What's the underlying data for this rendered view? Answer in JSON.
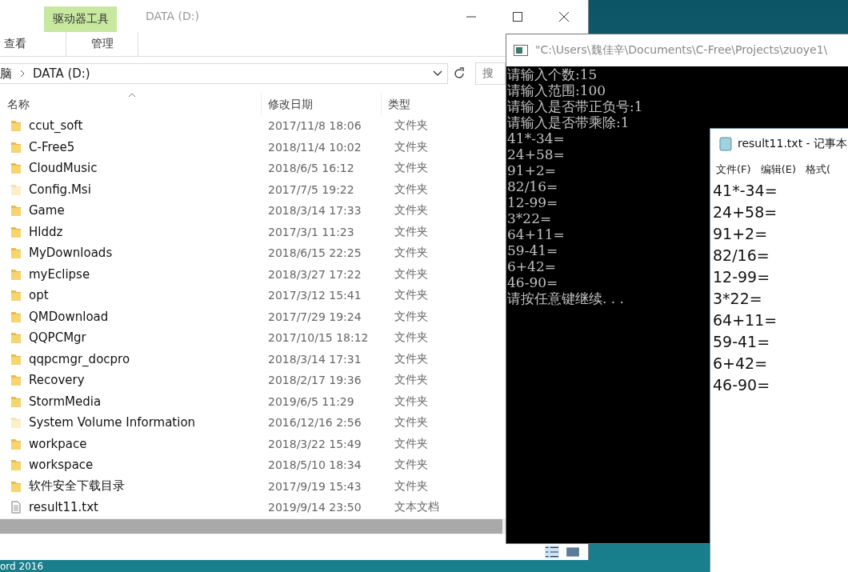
{
  "desktop": {
    "icon_label": "ord 2016"
  },
  "explorer": {
    "title": "DATA (D:)",
    "context_tab": "驱动器工具",
    "ribbon_tabs": [
      {
        "label": "查看",
        "contextual": false
      },
      {
        "label": "管理",
        "contextual": true
      }
    ],
    "address": {
      "path": [
        "脑",
        "DATA (D:)"
      ]
    },
    "search": {
      "placeholder": "搜"
    },
    "columns": [
      "名称",
      "修改日期",
      "类型"
    ],
    "files": [
      {
        "name": "ccut_soft",
        "date": "2017/11/8 18:06",
        "type": "文件夹",
        "kind": "folder",
        "hidden": false
      },
      {
        "name": "C-Free5",
        "date": "2018/11/4 10:02",
        "type": "文件夹",
        "kind": "folder",
        "hidden": false
      },
      {
        "name": "CloudMusic",
        "date": "2018/6/5 16:12",
        "type": "文件夹",
        "kind": "folder",
        "hidden": false
      },
      {
        "name": "Config.Msi",
        "date": "2017/7/5 19:22",
        "type": "文件夹",
        "kind": "folder",
        "hidden": true
      },
      {
        "name": "Game",
        "date": "2018/3/14 17:33",
        "type": "文件夹",
        "kind": "folder",
        "hidden": false
      },
      {
        "name": "Hlddz",
        "date": "2017/3/1 11:23",
        "type": "文件夹",
        "kind": "folder",
        "hidden": false
      },
      {
        "name": "MyDownloads",
        "date": "2018/6/15 22:25",
        "type": "文件夹",
        "kind": "folder",
        "hidden": false
      },
      {
        "name": "myEclipse",
        "date": "2018/3/27 17:22",
        "type": "文件夹",
        "kind": "folder",
        "hidden": false
      },
      {
        "name": "opt",
        "date": "2017/3/12 15:41",
        "type": "文件夹",
        "kind": "folder",
        "hidden": false
      },
      {
        "name": "QMDownload",
        "date": "2017/7/29 19:24",
        "type": "文件夹",
        "kind": "folder",
        "hidden": false
      },
      {
        "name": "QQPCMgr",
        "date": "2017/10/15 18:12",
        "type": "文件夹",
        "kind": "folder",
        "hidden": false
      },
      {
        "name": "qqpcmgr_docpro",
        "date": "2018/3/14 17:31",
        "type": "文件夹",
        "kind": "folder",
        "hidden": false
      },
      {
        "name": "Recovery",
        "date": "2018/2/17 19:36",
        "type": "文件夹",
        "kind": "folder",
        "hidden": false
      },
      {
        "name": "StormMedia",
        "date": "2019/6/5 11:29",
        "type": "文件夹",
        "kind": "folder",
        "hidden": false
      },
      {
        "name": "System Volume Information",
        "date": "2016/12/16 2:56",
        "type": "文件夹",
        "kind": "folder",
        "hidden": true
      },
      {
        "name": "workpace",
        "date": "2018/3/22 15:49",
        "type": "文件夹",
        "kind": "folder",
        "hidden": false
      },
      {
        "name": "workspace",
        "date": "2018/5/10 18:34",
        "type": "文件夹",
        "kind": "folder",
        "hidden": false
      },
      {
        "name": "软件安全下载目录",
        "date": "2017/9/19 15:43",
        "type": "文件夹",
        "kind": "folder",
        "hidden": false
      },
      {
        "name": "result11.txt",
        "date": "2019/9/14 23:50",
        "type": "文本文档",
        "kind": "text"
      }
    ]
  },
  "console": {
    "title": "\"C:\\Users\\魏佳辛\\Documents\\C-Free\\Projects\\zuoye1\\",
    "lines": [
      "请输入个数:15",
      "请输入范围:100",
      "请输入是否带正负号:1",
      "请输入是否带乘除:1",
      "41*-34=",
      "24+58=",
      "91+2=",
      "82/16=",
      "12-99=",
      "3*22=",
      "64+11=",
      "59-41=",
      "6+42=",
      "46-90=",
      "请按任意键继续. . ."
    ]
  },
  "notepad": {
    "title": "result11.txt - 记事本",
    "menu": [
      "文件(F)",
      "编辑(E)",
      "格式("
    ],
    "lines": [
      "41*-34=",
      "24+58=",
      "91+2=",
      "82/16=",
      "12-99=",
      "3*22=",
      "64+11=",
      "59-41=",
      "6+42=",
      "46-90="
    ]
  }
}
